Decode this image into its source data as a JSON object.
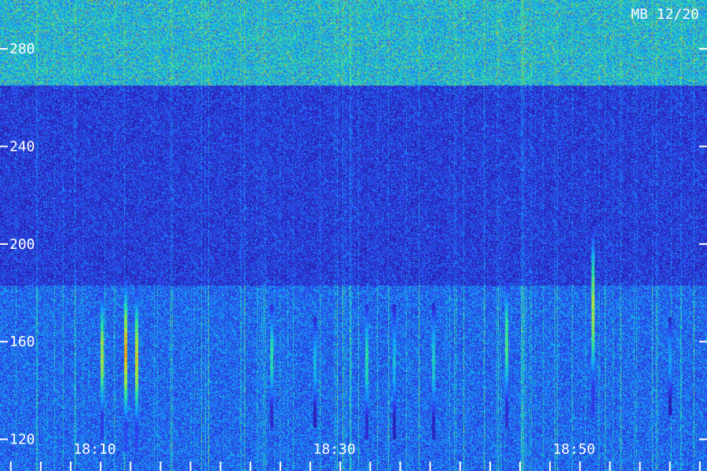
{
  "chart_data": {
    "type": "heatmap",
    "title": "MB 12/20",
    "ylim": [
      107,
      300
    ],
    "y_ticks": [
      "120",
      "160",
      "200",
      "240",
      "280"
    ],
    "y_tick_values": [
      120,
      160,
      200,
      240,
      280
    ],
    "x_labels": [
      "18:10",
      "18:30",
      "18:50"
    ],
    "x_label_minutes": [
      10,
      30,
      50
    ],
    "x_range_minutes": [
      2.1,
      61.1
    ],
    "colormap": [
      "#1a0a4a",
      "#2a13a0",
      "#2f3ff0",
      "#12a0ff",
      "#26e6a0",
      "#c8e62a",
      "#ff2a10"
    ],
    "bands": [
      {
        "y": [
          265,
          300
        ],
        "level": 0.55
      },
      {
        "y": [
          183,
          265
        ],
        "level": 0.3
      },
      {
        "y": [
          107,
          183
        ],
        "level": 0.4
      }
    ],
    "events": [
      {
        "t": 10.6,
        "y": [
          120,
          180
        ],
        "peak": 0.85
      },
      {
        "t": 12.6,
        "y": [
          115,
          185
        ],
        "peak": 0.95
      },
      {
        "t": 13.5,
        "y": [
          115,
          180
        ],
        "peak": 0.9
      },
      {
        "t": 24.8,
        "y": [
          125,
          175
        ],
        "peak": 0.7
      },
      {
        "t": 28.4,
        "y": [
          125,
          170
        ],
        "peak": 0.6
      },
      {
        "t": 32.7,
        "y": [
          120,
          175
        ],
        "peak": 0.7
      },
      {
        "t": 35.0,
        "y": [
          120,
          175
        ],
        "peak": 0.6
      },
      {
        "t": 38.3,
        "y": [
          120,
          175
        ],
        "peak": 0.65
      },
      {
        "t": 44.4,
        "y": [
          125,
          185
        ],
        "peak": 0.75
      },
      {
        "t": 51.6,
        "y": [
          130,
          205
        ],
        "peak": 0.85
      },
      {
        "t": 58.0,
        "y": [
          130,
          170
        ],
        "peak": 0.55
      }
    ]
  }
}
